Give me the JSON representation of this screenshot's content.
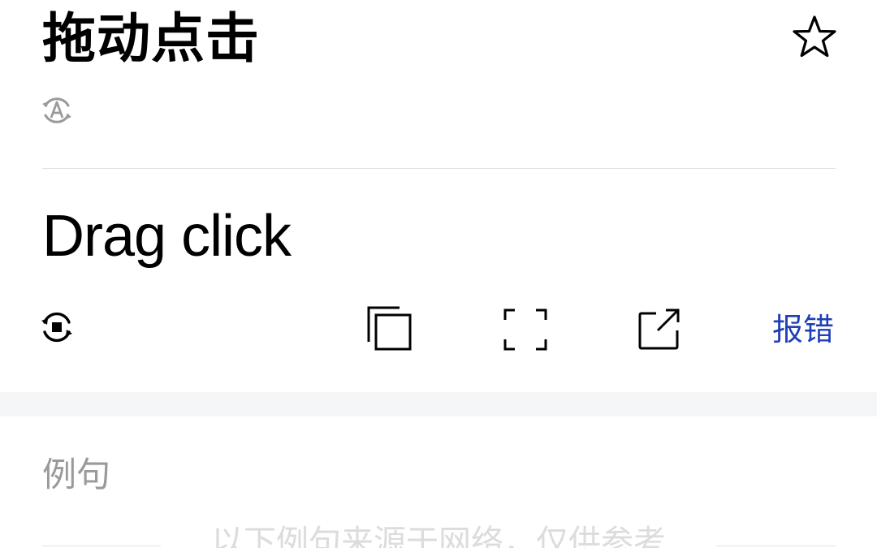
{
  "entry": {
    "source_text": "拖动点击",
    "translation_text": "Drag click"
  },
  "icons": {
    "favorite": "star-outline-icon",
    "source_language": "auto-detect-language-icon",
    "voice": "play-audio-icon",
    "copy": "copy-icon",
    "fullscreen": "fullscreen-icon",
    "open": "open-external-icon"
  },
  "toolbar": {
    "report_label": "报错"
  },
  "examples": {
    "section_title": "例句",
    "source_note": "以下例句来源于网络，仅供参考"
  },
  "colors": {
    "text": "#000000",
    "link": "#1f3fb6",
    "muted": "#9a9a9a",
    "divider": "#e2e2e2",
    "band": "#f5f6f8"
  }
}
